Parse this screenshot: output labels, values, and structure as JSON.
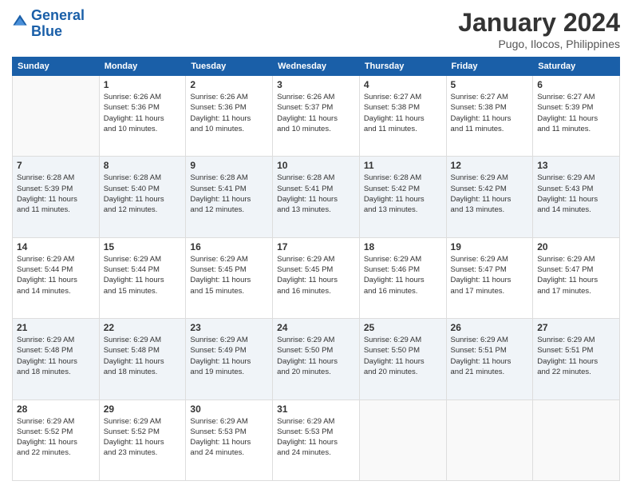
{
  "header": {
    "logo_line1": "General",
    "logo_line2": "Blue",
    "title": "January 2024",
    "subtitle": "Pugo, Ilocos, Philippines"
  },
  "days_of_week": [
    "Sunday",
    "Monday",
    "Tuesday",
    "Wednesday",
    "Thursday",
    "Friday",
    "Saturday"
  ],
  "weeks": [
    [
      {
        "day": "",
        "info": ""
      },
      {
        "day": "1",
        "info": "Sunrise: 6:26 AM\nSunset: 5:36 PM\nDaylight: 11 hours\nand 10 minutes."
      },
      {
        "day": "2",
        "info": "Sunrise: 6:26 AM\nSunset: 5:36 PM\nDaylight: 11 hours\nand 10 minutes."
      },
      {
        "day": "3",
        "info": "Sunrise: 6:26 AM\nSunset: 5:37 PM\nDaylight: 11 hours\nand 10 minutes."
      },
      {
        "day": "4",
        "info": "Sunrise: 6:27 AM\nSunset: 5:38 PM\nDaylight: 11 hours\nand 11 minutes."
      },
      {
        "day": "5",
        "info": "Sunrise: 6:27 AM\nSunset: 5:38 PM\nDaylight: 11 hours\nand 11 minutes."
      },
      {
        "day": "6",
        "info": "Sunrise: 6:27 AM\nSunset: 5:39 PM\nDaylight: 11 hours\nand 11 minutes."
      }
    ],
    [
      {
        "day": "7",
        "info": "Sunrise: 6:28 AM\nSunset: 5:39 PM\nDaylight: 11 hours\nand 11 minutes."
      },
      {
        "day": "8",
        "info": "Sunrise: 6:28 AM\nSunset: 5:40 PM\nDaylight: 11 hours\nand 12 minutes."
      },
      {
        "day": "9",
        "info": "Sunrise: 6:28 AM\nSunset: 5:41 PM\nDaylight: 11 hours\nand 12 minutes."
      },
      {
        "day": "10",
        "info": "Sunrise: 6:28 AM\nSunset: 5:41 PM\nDaylight: 11 hours\nand 13 minutes."
      },
      {
        "day": "11",
        "info": "Sunrise: 6:28 AM\nSunset: 5:42 PM\nDaylight: 11 hours\nand 13 minutes."
      },
      {
        "day": "12",
        "info": "Sunrise: 6:29 AM\nSunset: 5:42 PM\nDaylight: 11 hours\nand 13 minutes."
      },
      {
        "day": "13",
        "info": "Sunrise: 6:29 AM\nSunset: 5:43 PM\nDaylight: 11 hours\nand 14 minutes."
      }
    ],
    [
      {
        "day": "14",
        "info": "Sunrise: 6:29 AM\nSunset: 5:44 PM\nDaylight: 11 hours\nand 14 minutes."
      },
      {
        "day": "15",
        "info": "Sunrise: 6:29 AM\nSunset: 5:44 PM\nDaylight: 11 hours\nand 15 minutes."
      },
      {
        "day": "16",
        "info": "Sunrise: 6:29 AM\nSunset: 5:45 PM\nDaylight: 11 hours\nand 15 minutes."
      },
      {
        "day": "17",
        "info": "Sunrise: 6:29 AM\nSunset: 5:45 PM\nDaylight: 11 hours\nand 16 minutes."
      },
      {
        "day": "18",
        "info": "Sunrise: 6:29 AM\nSunset: 5:46 PM\nDaylight: 11 hours\nand 16 minutes."
      },
      {
        "day": "19",
        "info": "Sunrise: 6:29 AM\nSunset: 5:47 PM\nDaylight: 11 hours\nand 17 minutes."
      },
      {
        "day": "20",
        "info": "Sunrise: 6:29 AM\nSunset: 5:47 PM\nDaylight: 11 hours\nand 17 minutes."
      }
    ],
    [
      {
        "day": "21",
        "info": "Sunrise: 6:29 AM\nSunset: 5:48 PM\nDaylight: 11 hours\nand 18 minutes."
      },
      {
        "day": "22",
        "info": "Sunrise: 6:29 AM\nSunset: 5:48 PM\nDaylight: 11 hours\nand 18 minutes."
      },
      {
        "day": "23",
        "info": "Sunrise: 6:29 AM\nSunset: 5:49 PM\nDaylight: 11 hours\nand 19 minutes."
      },
      {
        "day": "24",
        "info": "Sunrise: 6:29 AM\nSunset: 5:50 PM\nDaylight: 11 hours\nand 20 minutes."
      },
      {
        "day": "25",
        "info": "Sunrise: 6:29 AM\nSunset: 5:50 PM\nDaylight: 11 hours\nand 20 minutes."
      },
      {
        "day": "26",
        "info": "Sunrise: 6:29 AM\nSunset: 5:51 PM\nDaylight: 11 hours\nand 21 minutes."
      },
      {
        "day": "27",
        "info": "Sunrise: 6:29 AM\nSunset: 5:51 PM\nDaylight: 11 hours\nand 22 minutes."
      }
    ],
    [
      {
        "day": "28",
        "info": "Sunrise: 6:29 AM\nSunset: 5:52 PM\nDaylight: 11 hours\nand 22 minutes."
      },
      {
        "day": "29",
        "info": "Sunrise: 6:29 AM\nSunset: 5:52 PM\nDaylight: 11 hours\nand 23 minutes."
      },
      {
        "day": "30",
        "info": "Sunrise: 6:29 AM\nSunset: 5:53 PM\nDaylight: 11 hours\nand 24 minutes."
      },
      {
        "day": "31",
        "info": "Sunrise: 6:29 AM\nSunset: 5:53 PM\nDaylight: 11 hours\nand 24 minutes."
      },
      {
        "day": "",
        "info": ""
      },
      {
        "day": "",
        "info": ""
      },
      {
        "day": "",
        "info": ""
      }
    ]
  ]
}
